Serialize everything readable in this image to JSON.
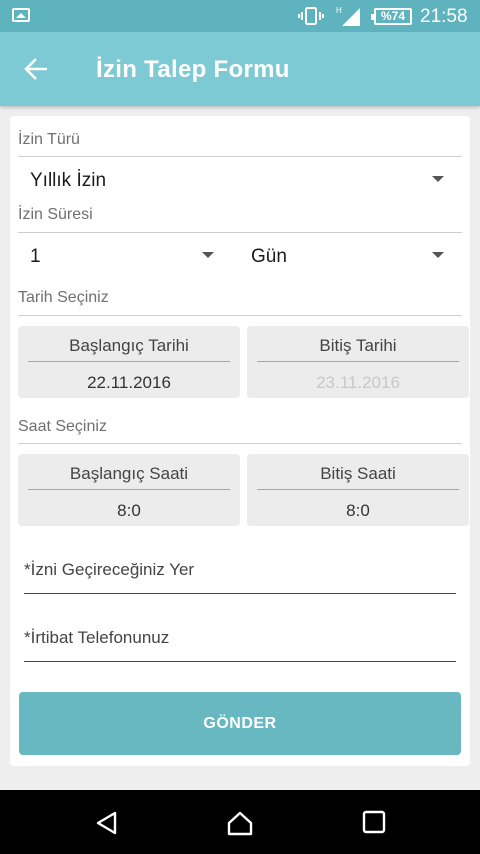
{
  "status_bar": {
    "battery": "%74",
    "clock": "21:58",
    "icons": [
      "image-icon",
      "vibrate-icon",
      "signal-icon",
      "battery-icon"
    ]
  },
  "app_bar": {
    "title": "İzin Talep Formu",
    "back_icon": "arrow-back-icon"
  },
  "form": {
    "leave_type": {
      "label": "İzin Türü",
      "value": "Yıllık İzin"
    },
    "duration": {
      "label": "İzin Süresi",
      "amount": "1",
      "unit": "Gün"
    },
    "dates": {
      "label": "Tarih Seçiniz",
      "start_title": "Başlangıç Tarihi",
      "start_value": "22.11.2016",
      "end_title": "Bitiş Tarihi",
      "end_value": "23.11.2016"
    },
    "times": {
      "label": "Saat Seçiniz",
      "start_title": "Başlangıç Saati",
      "start_value": "8:0",
      "end_title": "Bitiş Saati",
      "end_value": "8:0"
    },
    "location_placeholder": "*İzni Geçireceğiniz Yer",
    "phone_placeholder": "*İrtibat Telefonunuz",
    "submit_label": "GÖNDER"
  },
  "colors": {
    "status_bar": "#5fb3bf",
    "app_bar": "#7ecad4",
    "button": "#68b8c2",
    "box_background": "#ececec"
  },
  "nav_bar": {
    "icons": [
      "back-triangle-icon",
      "home-icon",
      "recents-icon"
    ]
  }
}
